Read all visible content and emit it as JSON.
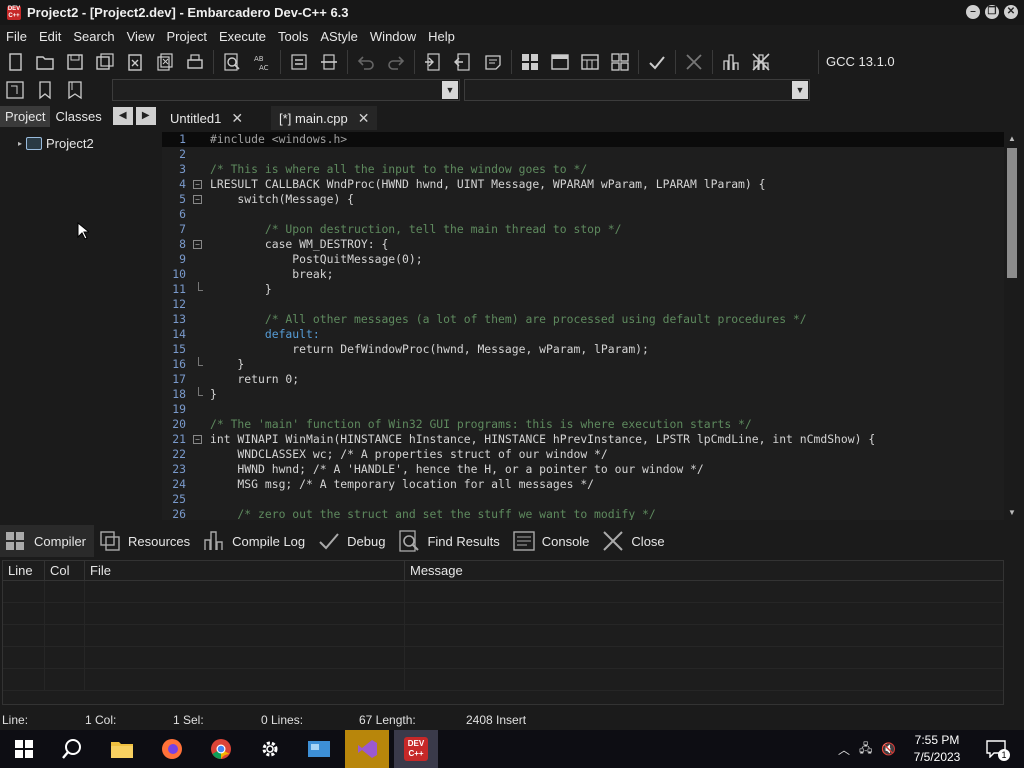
{
  "window": {
    "title": "Project2 - [Project2.dev] - Embarcadero Dev-C++ 6.3",
    "icon_text": "DEV C++"
  },
  "menu": [
    "File",
    "Edit",
    "Search",
    "View",
    "Project",
    "Execute",
    "Tools",
    "AStyle",
    "Window",
    "Help"
  ],
  "toolbar": {
    "compiler": "GCC 13.1.0",
    "icons": [
      "new-file-icon",
      "open-icon",
      "save-icon",
      "save-all-icon",
      "close-icon",
      "close-all-icon",
      "print-icon",
      "find-icon",
      "replace-icon",
      "indent-icon",
      "unindent-icon",
      "undo-icon",
      "redo-icon",
      "new-project-icon",
      "add-file-icon",
      "remove-file-icon",
      "compile-icon",
      "run-icon",
      "compile-run-icon",
      "rebuild-icon",
      "check-icon",
      "stop-icon",
      "chart-icon",
      "debug-icon"
    ]
  },
  "left_panel": {
    "tabs": [
      "Project",
      "Classes"
    ],
    "tree_root": "Project2"
  },
  "editor_tabs": [
    {
      "label": "Untitled1"
    },
    {
      "label": "[*] main.cpp"
    }
  ],
  "code_lines": [
    {
      "n": "1",
      "text": "#include <windows.h>"
    },
    {
      "n": "2",
      "text": ""
    },
    {
      "n": "3",
      "text": "/* This is where all the input to the window goes to */"
    },
    {
      "n": "4",
      "text": "LRESULT CALLBACK WndProc(HWND hwnd, UINT Message, WPARAM wParam, LPARAM lParam) {"
    },
    {
      "n": "5",
      "text": "    switch(Message) {"
    },
    {
      "n": "6",
      "text": ""
    },
    {
      "n": "7",
      "text": "        /* Upon destruction, tell the main thread to stop */"
    },
    {
      "n": "8",
      "text": "        case WM_DESTROY: {"
    },
    {
      "n": "9",
      "text": "            PostQuitMessage(0);"
    },
    {
      "n": "10",
      "text": "            break;"
    },
    {
      "n": "11",
      "text": "        }"
    },
    {
      "n": "12",
      "text": ""
    },
    {
      "n": "13",
      "text": "        /* All other messages (a lot of them) are processed using default procedures */"
    },
    {
      "n": "14",
      "text": "        default:"
    },
    {
      "n": "15",
      "text": "            return DefWindowProc(hwnd, Message, wParam, lParam);"
    },
    {
      "n": "16",
      "text": "    }"
    },
    {
      "n": "17",
      "text": "    return 0;"
    },
    {
      "n": "18",
      "text": "}"
    },
    {
      "n": "19",
      "text": ""
    },
    {
      "n": "20",
      "text": "/* The 'main' function of Win32 GUI programs: this is where execution starts */"
    },
    {
      "n": "21",
      "text": "int WINAPI WinMain(HINSTANCE hInstance, HINSTANCE hPrevInstance, LPSTR lpCmdLine, int nCmdShow) {"
    },
    {
      "n": "22",
      "text": "    WNDCLASSEX wc; /* A properties struct of our window */"
    },
    {
      "n": "23",
      "text": "    HWND hwnd; /* A 'HANDLE', hence the H, or a pointer to our window */"
    },
    {
      "n": "24",
      "text": "    MSG msg; /* A temporary location for all messages */"
    },
    {
      "n": "25",
      "text": ""
    },
    {
      "n": "26",
      "text": "    /* zero out the struct and set the stuff we want to modify */"
    }
  ],
  "bottom_tabs": [
    "Compiler",
    "Resources",
    "Compile Log",
    "Debug",
    "Find Results",
    "Console",
    "Close"
  ],
  "messages_table": {
    "columns": [
      "Line",
      "Col",
      "File",
      "Message"
    ]
  },
  "status": {
    "line_label": "Line:",
    "line_value": "1 Col:",
    "col_value": "1 Sel:",
    "sel_value": "0 Lines:",
    "lines_value": "67 Length:",
    "length_value": "2408 Insert"
  },
  "taskbar": {
    "time": "7:55 PM",
    "date": "7/5/2023",
    "notification_count": "1",
    "dev_icon_text": "DEV C++"
  }
}
